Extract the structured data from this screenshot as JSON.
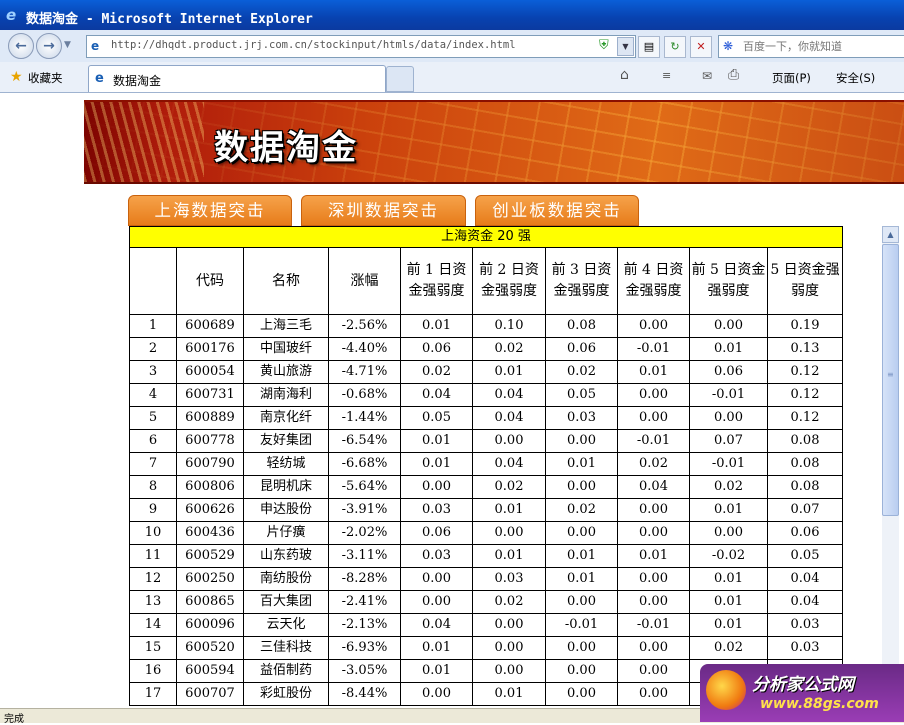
{
  "window": {
    "title": "数据淘金 - Microsoft Internet Explorer",
    "url": "http://dhqdt.product.jrj.com.cn/stockinput/htmls/data/index.html",
    "search_placeholder": "百度一下，你就知道",
    "favorites_label": "收藏夹",
    "tab_label": "数据淘金",
    "page_menu": "页面(P)",
    "safety_menu": "安全(S)",
    "status_text": "完成"
  },
  "banner": {
    "title": "数据淘金"
  },
  "tabs": [
    "上海数据突击",
    "深圳数据突击",
    "创业板数据突击"
  ],
  "table": {
    "caption": "上海资金 20 强",
    "headers": [
      "",
      "代码",
      "名称",
      "涨幅",
      "前 1 日资金强弱度",
      "前 2 日资金强弱度",
      "前 3 日资金强弱度",
      "前 4 日资金强弱度",
      "前 5 日资金强弱度",
      "5 日资金强弱度"
    ],
    "rows": [
      [
        "1",
        "600689",
        "上海三毛",
        "-2.56%",
        "0.01",
        "0.10",
        "0.08",
        "0.00",
        "0.00",
        "0.19"
      ],
      [
        "2",
        "600176",
        "中国玻纤",
        "-4.40%",
        "0.06",
        "0.02",
        "0.06",
        "-0.01",
        "0.01",
        "0.13"
      ],
      [
        "3",
        "600054",
        "黄山旅游",
        "-4.71%",
        "0.02",
        "0.01",
        "0.02",
        "0.01",
        "0.06",
        "0.12"
      ],
      [
        "4",
        "600731",
        "湖南海利",
        "-0.68%",
        "0.04",
        "0.04",
        "0.05",
        "0.00",
        "-0.01",
        "0.12"
      ],
      [
        "5",
        "600889",
        "南京化纤",
        "-1.44%",
        "0.05",
        "0.04",
        "0.03",
        "0.00",
        "0.00",
        "0.12"
      ],
      [
        "6",
        "600778",
        "友好集团",
        "-6.54%",
        "0.01",
        "0.00",
        "0.00",
        "-0.01",
        "0.07",
        "0.08"
      ],
      [
        "7",
        "600790",
        "轻纺城",
        "-6.68%",
        "0.01",
        "0.04",
        "0.01",
        "0.02",
        "-0.01",
        "0.08"
      ],
      [
        "8",
        "600806",
        "昆明机床",
        "-5.64%",
        "0.00",
        "0.02",
        "0.00",
        "0.04",
        "0.02",
        "0.08"
      ],
      [
        "9",
        "600626",
        "申达股份",
        "-3.91%",
        "0.03",
        "0.01",
        "0.02",
        "0.00",
        "0.01",
        "0.07"
      ],
      [
        "10",
        "600436",
        "片仔癀",
        "-2.02%",
        "0.06",
        "0.00",
        "0.00",
        "0.00",
        "0.00",
        "0.06"
      ],
      [
        "11",
        "600529",
        "山东药玻",
        "-3.11%",
        "0.03",
        "0.01",
        "0.01",
        "0.01",
        "-0.02",
        "0.05"
      ],
      [
        "12",
        "600250",
        "南纺股份",
        "-8.28%",
        "0.00",
        "0.03",
        "0.01",
        "0.00",
        "0.01",
        "0.04"
      ],
      [
        "13",
        "600865",
        "百大集团",
        "-2.41%",
        "0.00",
        "0.02",
        "0.00",
        "0.00",
        "0.01",
        "0.04"
      ],
      [
        "14",
        "600096",
        "云天化",
        "-2.13%",
        "0.04",
        "0.00",
        "-0.01",
        "-0.01",
        "0.01",
        "0.03"
      ],
      [
        "15",
        "600520",
        "三佳科技",
        "-6.93%",
        "0.01",
        "0.00",
        "0.00",
        "0.00",
        "0.02",
        "0.03"
      ],
      [
        "16",
        "600594",
        "益佰制药",
        "-3.05%",
        "0.01",
        "0.00",
        "0.00",
        "0.00",
        "",
        ""
      ],
      [
        "17",
        "600707",
        "彩虹股份",
        "-8.44%",
        "0.00",
        "0.01",
        "0.00",
        "0.00",
        "",
        ""
      ]
    ]
  },
  "watermark": {
    "title": "分析家公式网",
    "url": "www.88gs.com"
  }
}
